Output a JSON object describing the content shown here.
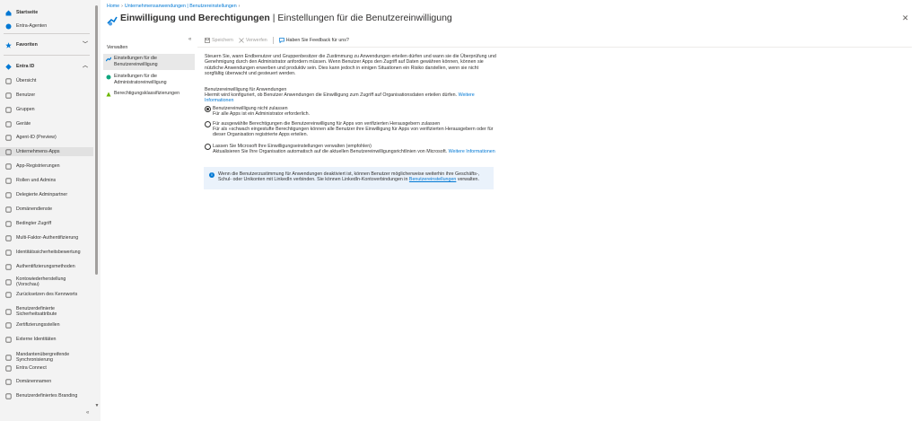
{
  "leftnav": {
    "items": [
      {
        "label": "Startseite",
        "icon": "home-icon",
        "color": "#0078d4",
        "bold": true
      },
      {
        "label": "Entra-Agenten",
        "icon": "agent-icon",
        "color": "#0078d4",
        "bold": false
      },
      {
        "label": "Favoriten",
        "icon": "star-icon",
        "color": "#0078d4",
        "bold": true,
        "chevron": "chevron-down-icon"
      },
      {
        "label": "Entra ID",
        "icon": "diamond-icon",
        "color": "#0078d4",
        "bold": true,
        "chevron": "chevron-up-icon"
      },
      {
        "label": "Übersicht",
        "icon": "info-icon",
        "color": "#605e5c"
      },
      {
        "label": "Benutzer",
        "icon": "user-icon",
        "color": "#605e5c"
      },
      {
        "label": "Gruppen",
        "icon": "group-icon",
        "color": "#605e5c"
      },
      {
        "label": "Geräte",
        "icon": "device-icon",
        "color": "#605e5c"
      },
      {
        "label": "Agent-ID (Preview)",
        "icon": "agent-id-icon",
        "color": "#605e5c"
      },
      {
        "label": "Unternehmens-Apps",
        "icon": "enterprise-apps-icon",
        "color": "#605e5c",
        "active": true
      },
      {
        "label": "App-Registrierungen",
        "icon": "app-registrations-icon",
        "color": "#605e5c"
      },
      {
        "label": "Rollen und Admins",
        "icon": "roles-icon",
        "color": "#605e5c"
      },
      {
        "label": "Delegierte Adminpartner",
        "icon": "partner-icon",
        "color": "#605e5c"
      },
      {
        "label": "Domänendienste",
        "icon": "domain-services-icon",
        "color": "#605e5c"
      },
      {
        "label": "Bedingter Zugriff",
        "icon": "conditional-access-icon",
        "color": "#605e5c"
      },
      {
        "label": "Multi-Faktor-Authentifizierung",
        "icon": "mfa-icon",
        "color": "#605e5c"
      },
      {
        "label": "Identitätssicherheitsbewertung",
        "icon": "identity-score-icon",
        "color": "#605e5c"
      },
      {
        "label": "Authentifizierungsmethoden",
        "icon": "auth-methods-icon",
        "color": "#605e5c"
      },
      {
        "label": "Kontowiederherstellung\n(Vorschau)",
        "icon": "account-recovery-icon",
        "color": "#605e5c"
      },
      {
        "label": "Zurücksetzen des Kennworts",
        "icon": "password-reset-icon",
        "color": "#605e5c"
      },
      {
        "label": "Benutzerdefinierte\nSicherheitsattribute",
        "icon": "security-attributes-icon",
        "color": "#605e5c"
      },
      {
        "label": "Zertifizierungsstellen",
        "icon": "certificate-icon",
        "color": "#605e5c"
      },
      {
        "label": "Externe Identitäten",
        "icon": "external-identities-icon",
        "color": "#605e5c"
      },
      {
        "label": "Mandantenübergreifende\nSynchronisierung",
        "icon": "cross-tenant-sync-icon",
        "color": "#605e5c"
      },
      {
        "label": "Entra Connect",
        "icon": "entra-connect-icon",
        "color": "#605e5c"
      },
      {
        "label": "Domänennamen",
        "icon": "domain-names-icon",
        "color": "#605e5c"
      },
      {
        "label": "Benutzerdefiniertes Branding",
        "icon": "branding-icon",
        "color": "#605e5c"
      }
    ],
    "collapse_icon": "double-chevron-left-icon"
  },
  "breadcrumb": [
    "Home",
    "Unternehmensanwendungen | Benutzereinstellungen"
  ],
  "header": {
    "title_strong": "Einwilligung und Berechtigungen",
    "title_rest": " | Einstellungen für die Benutzereinwilligung",
    "more": "···",
    "close": "✕"
  },
  "blade_nav": {
    "heading": "Verwalten",
    "collapse": "«",
    "items": [
      {
        "label": "Einstellungen für die\nBenutzereinwilligung",
        "icon": "consent-icon",
        "selected": true
      },
      {
        "label": "Einstellungen für die\nAdministratoreinwilligung",
        "icon": "admin-consent-icon"
      },
      {
        "label": "Berechtigungsklassifizierungen",
        "icon": "classification-icon"
      }
    ]
  },
  "toolbar": {
    "save": "Speichern",
    "discard": "Verwerfen",
    "feedback": "Haben Sie Feedback für uns?"
  },
  "content": {
    "intro": "Steuern Sie, wann Endbenutzer und Gruppenbesitzer die Zustimmung zu Anwendungen erteilen dürfen und wann sie die Überprüfung und Genehmigung durch den Administrator anfordern müssen. Wenn Benutzer Apps den Zugriff auf Daten gewähren können, können sie nützliche Anwendungen erwerben und produktiv sein. Dies kann jedoch in einigen Situationen ein Risiko darstellen, wenn sie nicht sorgfältig überwacht und gesteuert werden.",
    "section_title": "Benutzereinwilligung für Anwendungen",
    "section_desc": "Hiermit wird konfiguriert, ob Benutzer Anwendungen die Einwilligung zum Zugriff auf Organisationsdaten erteilen dürfen.",
    "section_link": "Weitere Informationen",
    "options": [
      {
        "title": "Benutzereinwilligung nicht zulassen",
        "desc": "Für alle Apps ist ein Administrator erforderlich.",
        "checked": true
      },
      {
        "title": "Für ausgewählte Berechtigungen die Benutzereinwilligung für Apps von verifizierten Herausgebern zulassen",
        "desc": "Für als »schwach eingestufte Berechtigungen können alle Benutzer ihre Einwilligung für Apps von verifizierten Herausgebern oder für dieser Organisation registrierte Apps erteilen.",
        "checked": false
      },
      {
        "title": "Lassen Sie Microsoft Ihre Einwilligungseinstellungen verwalten (empfohlen)",
        "desc": "Aktualisieren Sie Ihre Organisation automatisch auf die aktuellen Benutzereinwilligungsrichtlinien von Microsoft.",
        "link": "Weitere Informationen",
        "checked": false
      }
    ],
    "info_text": "Wenn die Benutzerzustimmung für Anwendungen deaktiviert ist, können Benutzer möglicherweise weiterhin ihre Geschäfts-, Schul- oder Unikonten mit LinkedIn verbinden. Sie können LinkedIn-Kontoverbindungen in",
    "info_link": "Benutzereinstellungen",
    "info_end": " verwalten."
  },
  "colors": {
    "accent": "#0078d4",
    "nav_bg": "#f3f3f3",
    "info_bg": "#eaf2fb"
  }
}
